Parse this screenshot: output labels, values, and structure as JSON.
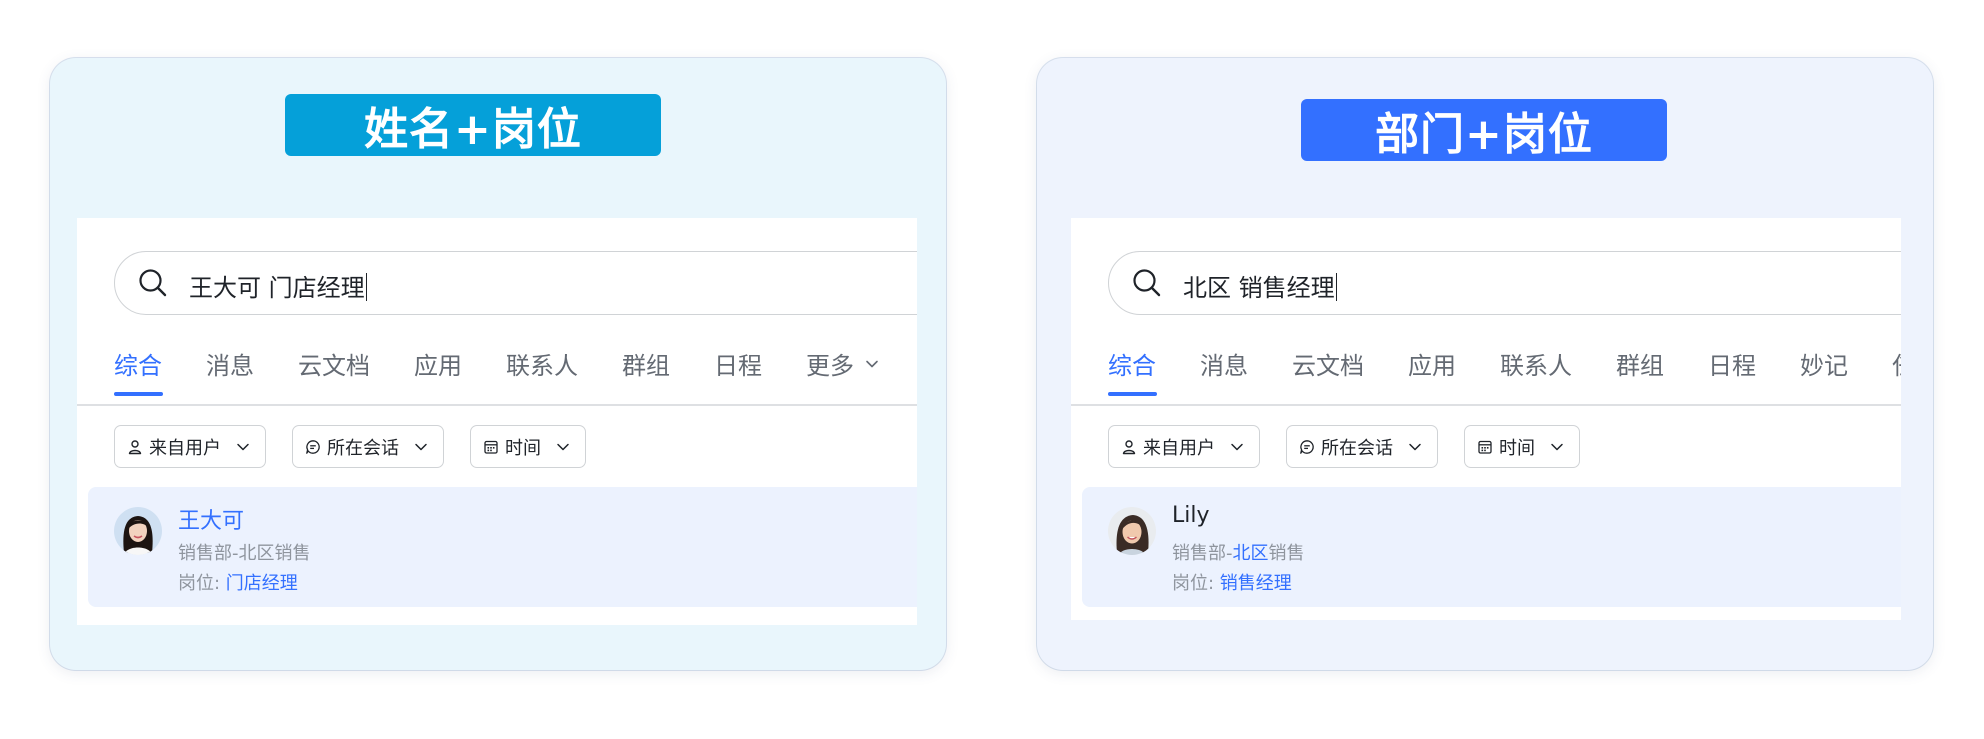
{
  "colors": {
    "left_tag_bg": "#05a0d9",
    "right_tag_bg": "#3370ff",
    "accent": "#3370ff"
  },
  "cards": [
    {
      "tag": "姓名+岗位",
      "query": "王大可 门店经理",
      "tabs": [
        "综合",
        "消息",
        "云文档",
        "应用",
        "联系人",
        "群组",
        "日程",
        "更多"
      ],
      "active_tab": "综合",
      "filters": [
        {
          "label": "来自用户",
          "icon": "person-icon"
        },
        {
          "label": "所在会话",
          "icon": "chat-icon"
        },
        {
          "label": "时间",
          "icon": "calendar-icon"
        }
      ],
      "result": {
        "name": "王大可",
        "dept_prefix": "销售部-北区销售",
        "dept_highlight": "",
        "dept_suffix": "",
        "position_prefix": "岗位: ",
        "position_highlight": "门店经理"
      }
    },
    {
      "tag": "部门+岗位",
      "query": "北区 销售经理",
      "tabs": [
        "综合",
        "消息",
        "云文档",
        "应用",
        "联系人",
        "群组",
        "日程",
        "妙记",
        "任"
      ],
      "active_tab": "综合",
      "filters": [
        {
          "label": "来自用户",
          "icon": "person-icon"
        },
        {
          "label": "所在会话",
          "icon": "chat-icon"
        },
        {
          "label": "时间",
          "icon": "calendar-icon"
        }
      ],
      "result": {
        "name": "Lily",
        "dept_prefix": "销售部-",
        "dept_highlight": "北区",
        "dept_suffix": "销售",
        "position_prefix": "岗位: ",
        "position_highlight": "销售经理"
      }
    }
  ]
}
